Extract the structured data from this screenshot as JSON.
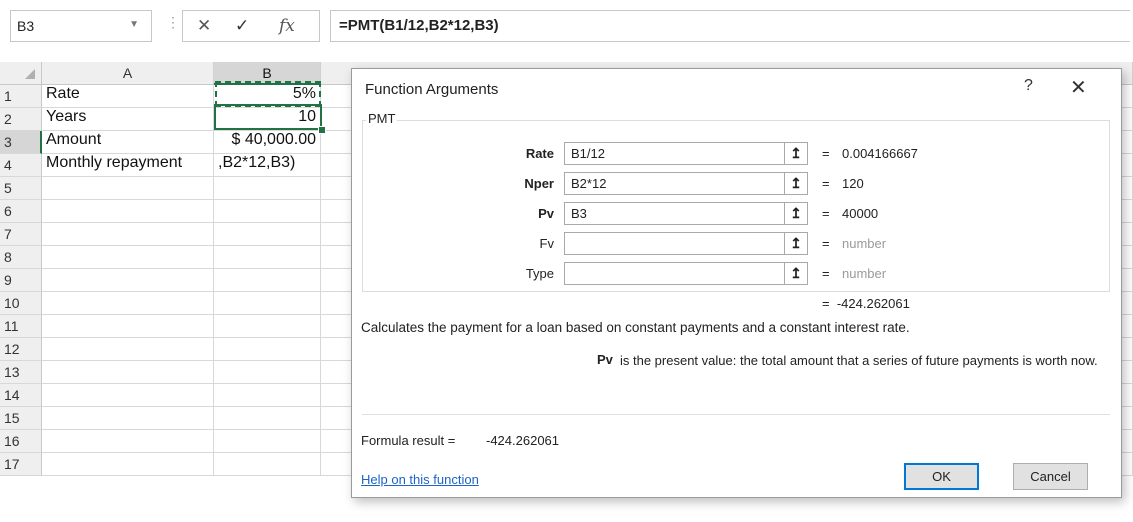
{
  "formula_bar": {
    "name_box": "B3",
    "name_box_dropdown_icon": "chevron-down-icon",
    "cancel_icon": "✕",
    "enter_icon": "✓",
    "fx_icon": "fx",
    "formula": "=PMT(B1/12,B2*12,B3)"
  },
  "sheet": {
    "columns": [
      "A",
      "B"
    ],
    "rows": [
      "1",
      "2",
      "3",
      "4",
      "5",
      "6",
      "7",
      "8",
      "9",
      "10",
      "11",
      "12",
      "13",
      "14",
      "15",
      "16",
      "17"
    ],
    "cells": {
      "A1": "Rate",
      "B1": "5%",
      "A2": "Years",
      "B2": "10",
      "A3": "Amount",
      "B3": "$ 40,000.00",
      "A4": "Monthly repayment",
      "B4": ",B2*12,B3)"
    },
    "accent": "#217346"
  },
  "dialog": {
    "title": "Function Arguments",
    "help_glyph": "?",
    "close_glyph": "✕",
    "function_name": "PMT",
    "args": [
      {
        "label": "Rate",
        "value": "B1/12",
        "result": "0.004166667",
        "bold": true
      },
      {
        "label": "Nper",
        "value": "B2*12",
        "result": "120",
        "bold": true
      },
      {
        "label": "Pv",
        "value": "B3",
        "result": "40000",
        "bold": true
      },
      {
        "label": "Fv",
        "value": "",
        "result": "number",
        "bold": false
      },
      {
        "label": "Type",
        "value": "",
        "result": "number",
        "bold": false
      }
    ],
    "collapse_glyph": "↥",
    "equals": "=",
    "result": "-424.262061",
    "description": "Calculates the payment for a loan based on constant payments and a constant interest rate.",
    "arg_help_key": "Pv",
    "arg_help_text": "is the present value: the total amount that a series of future payments is worth now.",
    "formula_result_label": "Formula result =",
    "formula_result_value": "-424.262061",
    "help_link": "Help on this function",
    "ok_label": "OK",
    "cancel_label": "Cancel"
  }
}
